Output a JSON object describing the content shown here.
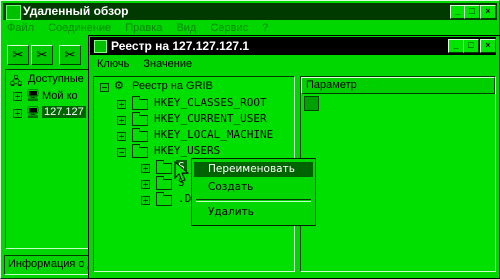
{
  "outer_window": {
    "title": "Удаленный обзор",
    "menu": [
      "Файл",
      "Соединение",
      "Правка",
      "Вид",
      "Сервис",
      "?"
    ],
    "tree": {
      "root_label": "Доступные",
      "items": [
        "Мой ко",
        "127.127"
      ]
    },
    "status_text": "Информация о д"
  },
  "inner_window": {
    "title": "Реестр на 127.127.127.1",
    "menu": [
      "Ключь",
      "Значение"
    ],
    "tree": {
      "root": "Реестр на GRIB",
      "hives": [
        "HKEY_CLASSES_ROOT",
        "HKEY_CURRENT_USER",
        "HKEY_LOCAL_MACHINE",
        "HKEY_USERS"
      ],
      "subkeys": [
        "S",
        "S",
        ".D"
      ]
    },
    "list_header": "Параметр"
  },
  "context_menu": {
    "items": [
      "Переименовать",
      "Создать",
      "Удалить"
    ]
  },
  "caption_buttons": [
    "_",
    "□",
    "×"
  ],
  "colors": {
    "background": "#00d600",
    "titlebar": "#000000",
    "selection": "#006400"
  }
}
